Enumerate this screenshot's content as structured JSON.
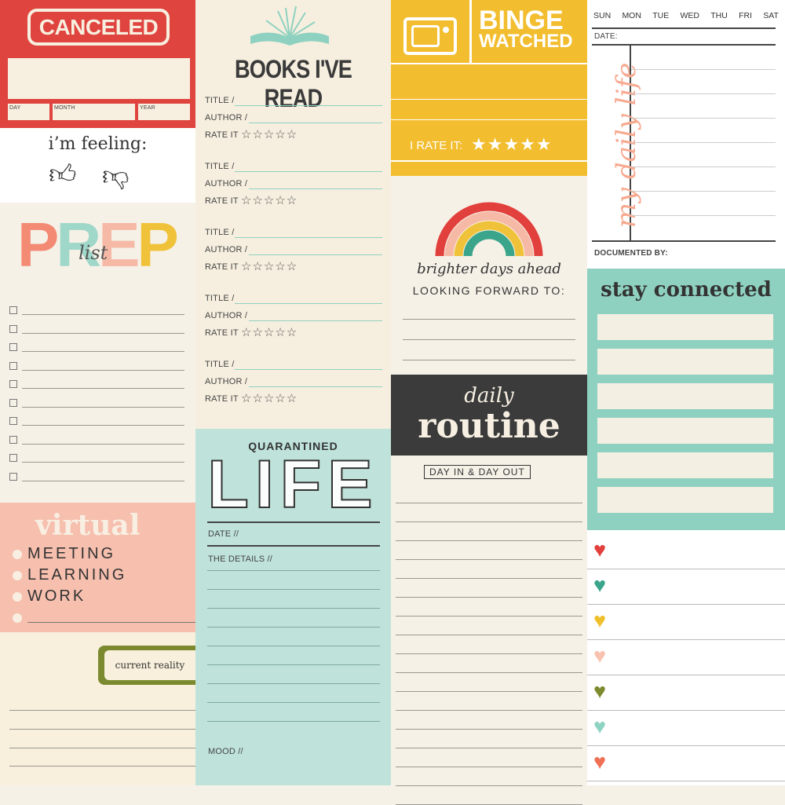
{
  "colors": {
    "red": "#e0443f",
    "cream": "#f6f0e2",
    "pink": "#f6bfae",
    "teal": "#bfe3da",
    "yellow": "#f2bd2e",
    "dark": "#3b3b3b",
    "mint": "#8fd1c0",
    "olive": "#7b8a2e"
  },
  "canceled": {
    "title": "CANCELED",
    "day": "DAY",
    "month": "MONTH",
    "year": "YEAR"
  },
  "feeling": {
    "title": "i’m feeling:",
    "up_icon": "thumbs-up-icon",
    "down_icon": "thumbs-down-icon"
  },
  "prep": {
    "letters": [
      "P",
      "R",
      "E",
      "P"
    ],
    "letter_colors": [
      "#f38b74",
      "#9fd7c9",
      "#f6b9a6",
      "#f0c23a"
    ],
    "script": "list",
    "items": 10
  },
  "virtual": {
    "title": "virtual",
    "items": [
      "MEETING",
      "LEARNING",
      "WORK",
      ""
    ]
  },
  "reality": {
    "label": "current reality"
  },
  "books": {
    "title": "BOOKS I'VE READ",
    "title_label": "TITLE /",
    "author_label": "AUTHOR /",
    "rate_label": "RATE IT",
    "stars": "☆☆☆☆☆",
    "entries": 5
  },
  "quarantined": {
    "kicker": "QUARANTINED",
    "title": "LIFE",
    "date": "DATE //",
    "details": "THE DETAILS //",
    "mood": "MOOD //"
  },
  "binge": {
    "title1": "BINGE",
    "title2": "WATCHED",
    "rate": "I RATE IT:",
    "stars": "★★★★★",
    "icon": "tv-icon"
  },
  "brighter": {
    "script": "brighter days ahead",
    "forward": "LOOKING FORWARD TO:",
    "icon": "rainbow-icon"
  },
  "routine": {
    "script": "daily",
    "title": "routine",
    "tag": "DAY IN & DAY OUT"
  },
  "daily_life": {
    "days": [
      "SUN",
      "MON",
      "TUE",
      "WED",
      "THU",
      "FRI",
      "SAT"
    ],
    "date": "DATE:",
    "script": "my daily life",
    "documented": "DOCUMENTED BY:"
  },
  "stay": {
    "title": "stay connected"
  },
  "hearts": [
    "#e2403c",
    "#3aa58a",
    "#f0c02c",
    "#f8c2b0",
    "#7d8a2d",
    "#8fd3c3",
    "#f07055"
  ]
}
